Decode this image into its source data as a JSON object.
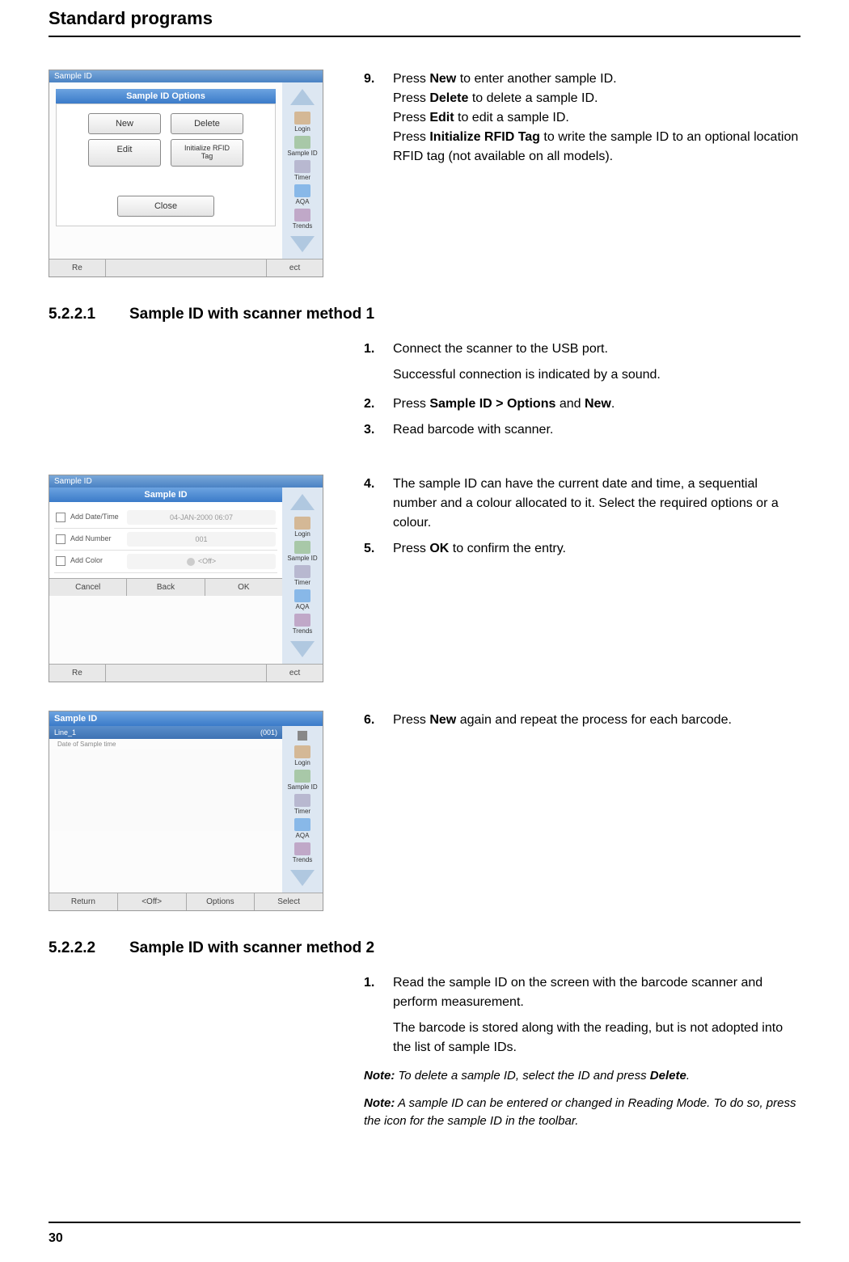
{
  "header": "Standard programs",
  "page_number": "30",
  "block1": {
    "steps": [
      {
        "num": "9.",
        "html": "Press <b>New</b> to enter another sample ID.<br>Press <b>Delete</b> to delete a sample ID.<br>Press <b>Edit</b> to edit a sample ID.<br>Press <b>Initialize RFID Tag</b> to write the sample ID to an optional location RFID tag (not available on all models)."
      }
    ],
    "ss": {
      "title": "Sample ID Options",
      "btn_new": "New",
      "btn_delete": "Delete",
      "btn_edit": "Edit",
      "btn_rfid": "Initialize RFID Tag",
      "btn_close": "Close",
      "left_stub": "Re",
      "right_stub": "ect"
    }
  },
  "heading1": {
    "num": "5.2.2.1",
    "title": "Sample ID with scanner method 1"
  },
  "block2": {
    "steps": [
      {
        "num": "1.",
        "text": "Connect the scanner to the USB port."
      },
      {
        "sub": "Successful connection is indicated by a sound."
      },
      {
        "num": "2.",
        "html": "Press <b>Sample ID > Options</b> and <b>New</b>."
      },
      {
        "num": "3.",
        "text": "Read barcode with scanner."
      }
    ]
  },
  "block3": {
    "steps": [
      {
        "num": "4.",
        "text": "The sample ID can have the current date and time, a sequential number and a colour allocated to it. Select the required options or a colour."
      },
      {
        "num": "5.",
        "html": "Press <b>OK</b> to confirm the entry."
      }
    ],
    "ss": {
      "title": "Sample ID",
      "row1_label": "Add Date/Time",
      "row1_value": "04-JAN-2000 06:07",
      "row2_label": "Add Number",
      "row2_value": "001",
      "row3_label": "Add Color",
      "row3_value": "<Off>",
      "btn_cancel": "Cancel",
      "btn_back": "Back",
      "btn_ok": "OK",
      "left_stub": "Re",
      "right_stub": "ect"
    }
  },
  "block4": {
    "steps": [
      {
        "num": "6.",
        "html": "Press <b>New</b> again and repeat the process for each barcode."
      }
    ],
    "ss": {
      "title": "Sample ID",
      "row_label": "Line_1",
      "row_count": "(001)",
      "row_sub": "Date of Sample time",
      "btn_return": "Return",
      "btn_off": "<Off>",
      "btn_options": "Options",
      "btn_select": "Select"
    }
  },
  "heading2": {
    "num": "5.2.2.2",
    "title": "Sample ID with scanner method 2"
  },
  "block5": {
    "steps": [
      {
        "num": "1.",
        "text": "Read the sample ID on the screen with the barcode scanner and perform measurement."
      },
      {
        "sub": "The barcode is stored along with the reading, but is not adopted into the list of sample IDs."
      }
    ],
    "note1": {
      "label": "Note:",
      "html": " To delete a sample ID, select the ID and press <b>Delete</b>."
    },
    "note2": {
      "label": "Note:",
      "text": " A sample ID can be entered or changed in Reading Mode. To do so, press the icon for the sample ID in the toolbar."
    }
  },
  "sidebar": {
    "login": "Login",
    "sample": "Sample ID",
    "timer": "Timer",
    "aqa": "AQA",
    "trends": "Trends"
  }
}
